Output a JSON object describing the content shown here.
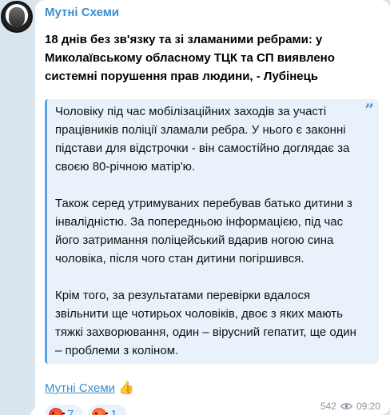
{
  "channel": {
    "name": "Мутні Схеми"
  },
  "post": {
    "headline": "18 днів без зв'язку та зі зламаними ребрами: у Миколаївському обласному ТЦК та СП виявлено системні порушення прав людини, - Лубінець",
    "quote": {
      "paragraphs": [
        "Чоловіку під час мобілізаційних заходів за участі працівників поліції зламали ребра. У нього є законні підстави для відстрочки - він самостійно доглядає за своєю 80-річною матір'ю.",
        "Також серед утримуваних перебував батько дитини з інвалідністю. За попередньою інформацією, під час його затримання поліцейський вдарив ногою сина чоловіка, після чого стан дитини погіршився.",
        "Крім того, за результатами перевірки вдалося звільнити ще чотирьох чоловіків, двоє з яких мають тяжкі захворювання, один – вірусний гепатит, ще один – проблеми з коліном."
      ]
    },
    "signature": {
      "link": "Мутні Схеми",
      "emoji": "👍"
    }
  },
  "reactions": [
    {
      "icon": "angry-face-icon",
      "count": "7"
    },
    {
      "icon": "pouting-face-icon",
      "count": "1"
    }
  ],
  "footer": {
    "views": "542",
    "time": "09:20"
  },
  "colors": {
    "accent": "#3a8fd0",
    "quote_bg": "#e9f2fb",
    "quote_border": "#5ca1e0",
    "chat_bg": "#d8e4ee"
  }
}
